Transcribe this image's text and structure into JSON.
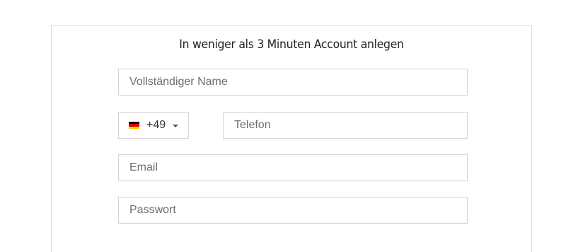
{
  "form": {
    "title": "In weniger als 3 Minuten Account anlegen",
    "full_name": {
      "placeholder": "Vollständiger Name",
      "value": ""
    },
    "country": {
      "flag": "germany-flag",
      "dial_code": "+49",
      "icon": "caret-down-icon"
    },
    "phone": {
      "placeholder": "Telefon",
      "value": ""
    },
    "email": {
      "placeholder": "Email",
      "value": ""
    },
    "password": {
      "placeholder": "Passwort",
      "value": ""
    }
  },
  "colors": {
    "border": "#d4d4d4",
    "title_text": "#222222",
    "placeholder_text": "#6e6e6e"
  }
}
